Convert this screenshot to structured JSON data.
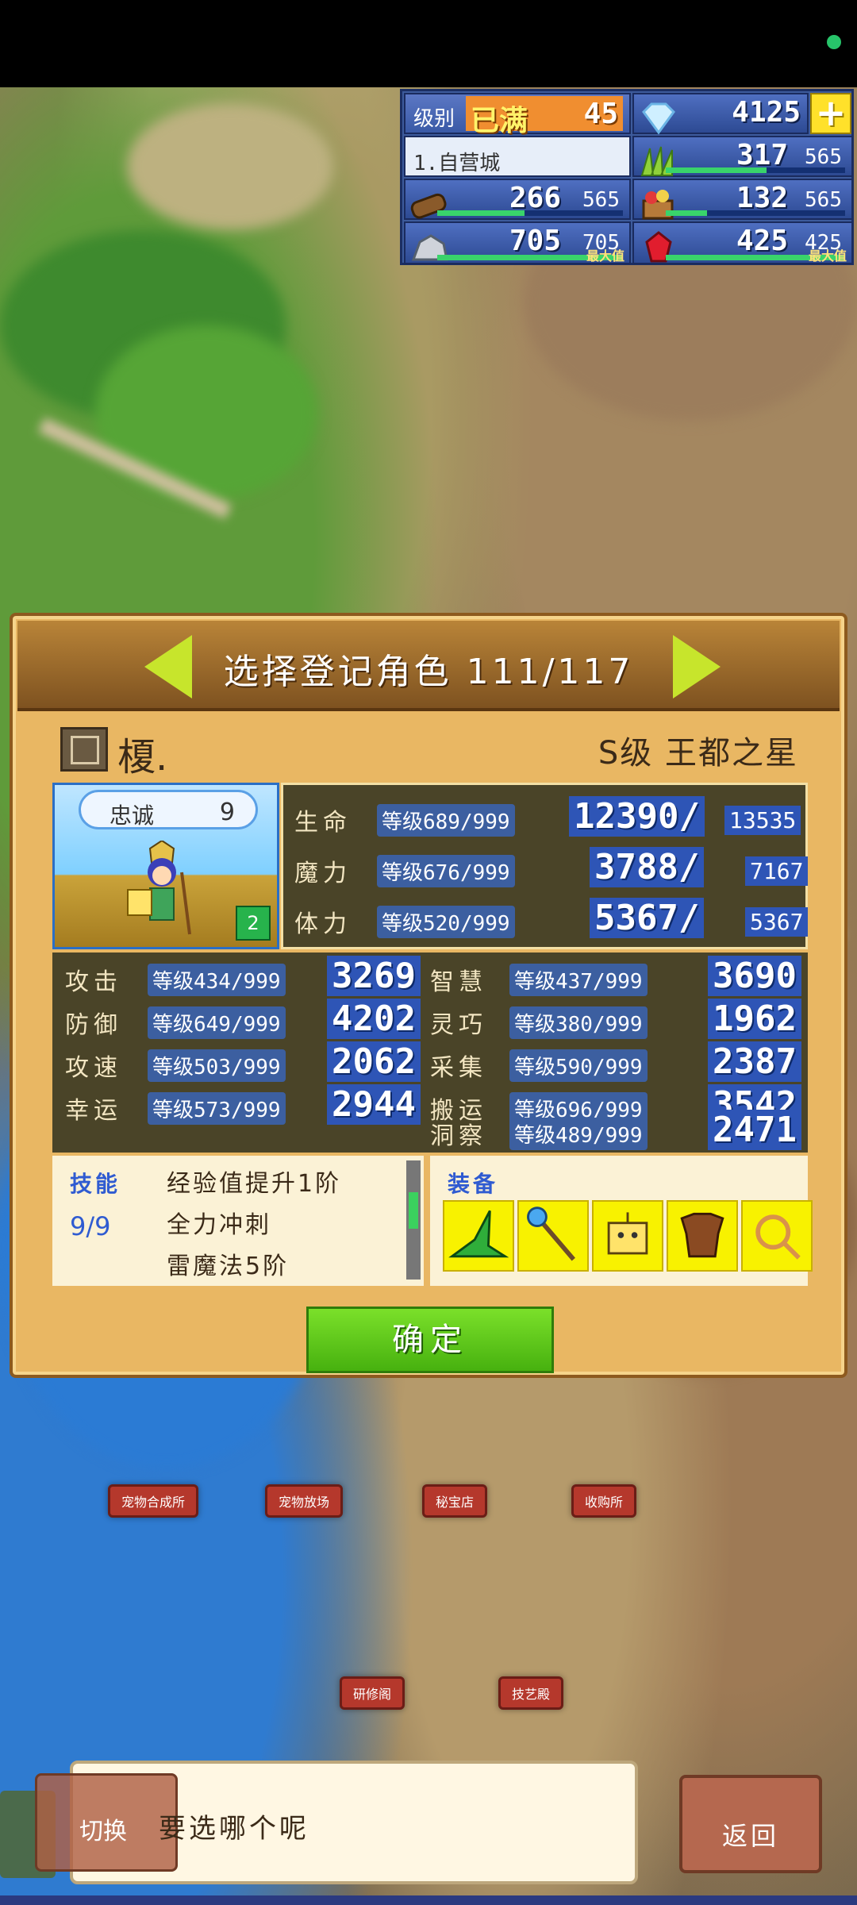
{
  "resources": {
    "level_label": "级别",
    "level_status": "已满",
    "level_value": "45",
    "gems": "4125",
    "plus_symbol": "+",
    "town_name": "1.自营城",
    "grass": {
      "value": "317",
      "max": "565",
      "fill": 0.56
    },
    "wood": {
      "value": "266",
      "max": "565",
      "fill": 0.47
    },
    "food": {
      "value": "132",
      "max": "565",
      "fill": 0.23
    },
    "stone": {
      "value": "705",
      "max": "705",
      "fill": 1.0,
      "max_label": "最大值"
    },
    "ruby": {
      "value": "425",
      "max": "425",
      "fill": 1.0,
      "max_label": "最大值"
    }
  },
  "dialog": {
    "title": "选择登记角色 111/117",
    "char_name": "榎.",
    "char_rank": "S级 王都之星",
    "loyalty_label": "忠诚",
    "loyalty_value": "9",
    "party_count": "2",
    "primary_stats": [
      {
        "label": "生命",
        "level": "等级689/999",
        "value": "12390/",
        "max": "13535"
      },
      {
        "label": "魔力",
        "level": "等级676/999",
        "value": "3788/",
        "max": "7167"
      },
      {
        "label": "体力",
        "level": "等级520/999",
        "value": "5367/",
        "max": "5367"
      }
    ],
    "left_stats": [
      {
        "label": "攻击",
        "level": "等级434/999",
        "value": "3269"
      },
      {
        "label": "防御",
        "level": "等级649/999",
        "value": "4202"
      },
      {
        "label": "攻速",
        "level": "等级503/999",
        "value": "2062"
      },
      {
        "label": "幸运",
        "level": "等级573/999",
        "value": "2944"
      }
    ],
    "right_stats": [
      {
        "label": "智慧",
        "level": "等级437/999",
        "value": "3690"
      },
      {
        "label": "灵巧",
        "level": "等级380/999",
        "value": "1962"
      },
      {
        "label": "采集",
        "level": "等级590/999",
        "value": "2387"
      },
      {
        "label": "搬运",
        "level": "等级696/999",
        "value": "3542"
      },
      {
        "label": "洞察",
        "level": "等级489/999",
        "value": "2471"
      }
    ],
    "skills_title": "技能",
    "skills_count": "9/9",
    "skills": [
      "经验值提升1阶",
      "全力冲刺",
      "雷魔法5阶"
    ],
    "equip_title": "装备",
    "equip_icons": [
      "witch-hat-icon",
      "staff-icon",
      "robot-head-icon",
      "leather-armor-icon",
      "rope-whip-icon"
    ],
    "confirm_label": "确定"
  },
  "buildings": [
    "宠物合成所",
    "宠物放场",
    "秘宝店",
    "收购所",
    "研修阁",
    "技艺殿"
  ],
  "bottom": {
    "message": "要选哪个呢",
    "switch_label": "切换",
    "back_label": "返回"
  }
}
